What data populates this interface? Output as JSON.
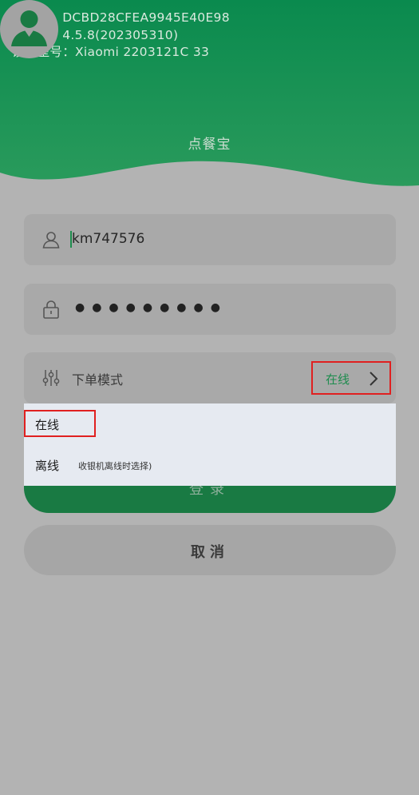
{
  "device_info": {
    "serial": "序列号：DCBD28CFEA9945E40E98",
    "version": "版本号：4.5.8(202305310)",
    "model": "设备型号：Xiaomi 2203121C 33"
  },
  "app": {
    "name": "点餐宝"
  },
  "form": {
    "username": "km747576",
    "password_mask": "●●●●●●●●●",
    "mode_label": "下单模式",
    "mode_value": "在线"
  },
  "dropdown": {
    "options": [
      {
        "label": "在线"
      },
      {
        "label": "离线",
        "hint": "收银机离线时选择)"
      }
    ]
  },
  "buttons": {
    "login": "登录",
    "cancel": "取消"
  },
  "colors": {
    "brand_green": "#1e8c4e",
    "highlight_red": "#e02020"
  }
}
